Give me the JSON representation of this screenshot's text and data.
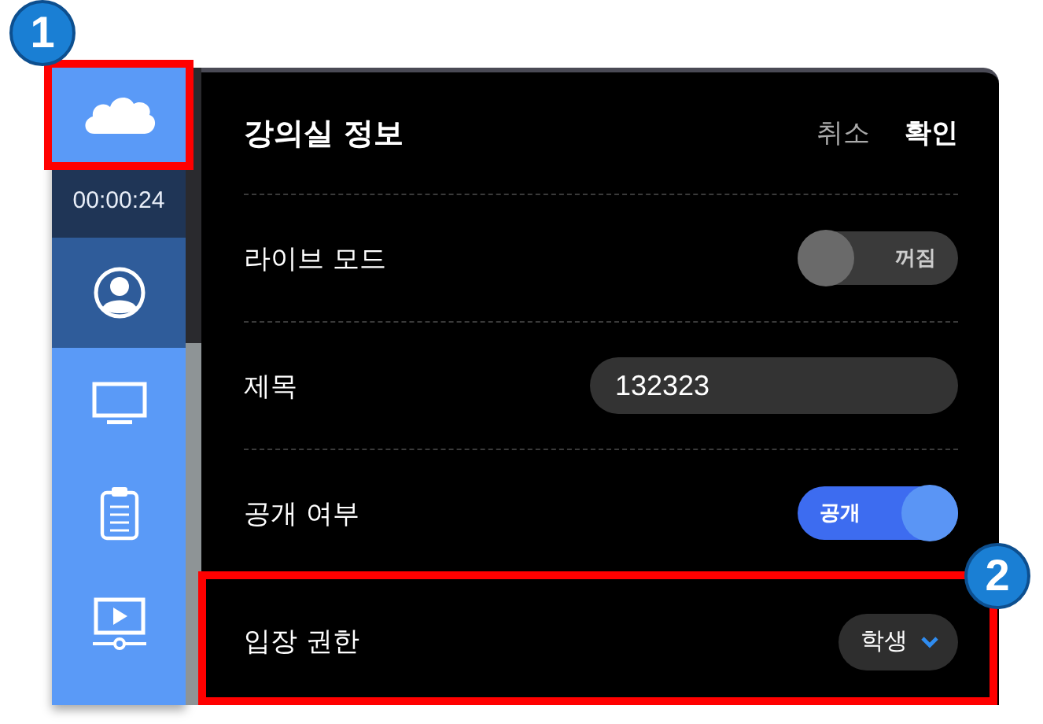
{
  "sidebar": {
    "items": [
      {
        "kind": "logo"
      },
      {
        "kind": "timer",
        "text": "00:00:24"
      },
      {
        "kind": "profile"
      },
      {
        "kind": "screen"
      },
      {
        "kind": "clipboard"
      },
      {
        "kind": "video"
      }
    ]
  },
  "panel": {
    "title": "강의실 정보",
    "actions": [
      {
        "label": "취소",
        "primary": false
      },
      {
        "label": "확인",
        "primary": true
      }
    ],
    "rows": [
      {
        "kind": "toggle",
        "label": "라이브 모드",
        "on": false,
        "state_text": "꺼짐"
      },
      {
        "kind": "text",
        "label": "제목",
        "value": "132323"
      },
      {
        "kind": "toggle",
        "label": "공개 여부",
        "on": true,
        "state_text": "공개"
      },
      {
        "kind": "select",
        "label": "입장 권한",
        "value": "학생"
      }
    ]
  },
  "callouts": [
    {
      "label": "1"
    },
    {
      "label": "2"
    }
  ]
}
